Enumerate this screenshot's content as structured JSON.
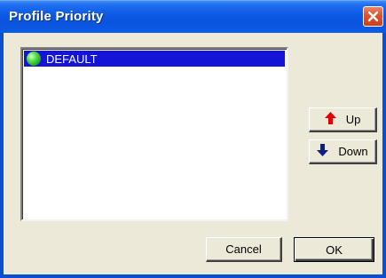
{
  "window": {
    "title": "Profile Priority"
  },
  "profiles": [
    {
      "label": "DEFAULT",
      "icon": "green-status-icon",
      "selected": true
    }
  ],
  "buttons": {
    "up": "Up",
    "down": "Down",
    "cancel": "Cancel",
    "ok": "OK"
  },
  "colors": {
    "titlebar": "#0a54dd",
    "selection": "#1414d8",
    "up_arrow": "#e00000",
    "down_arrow": "#0a1e8a"
  }
}
